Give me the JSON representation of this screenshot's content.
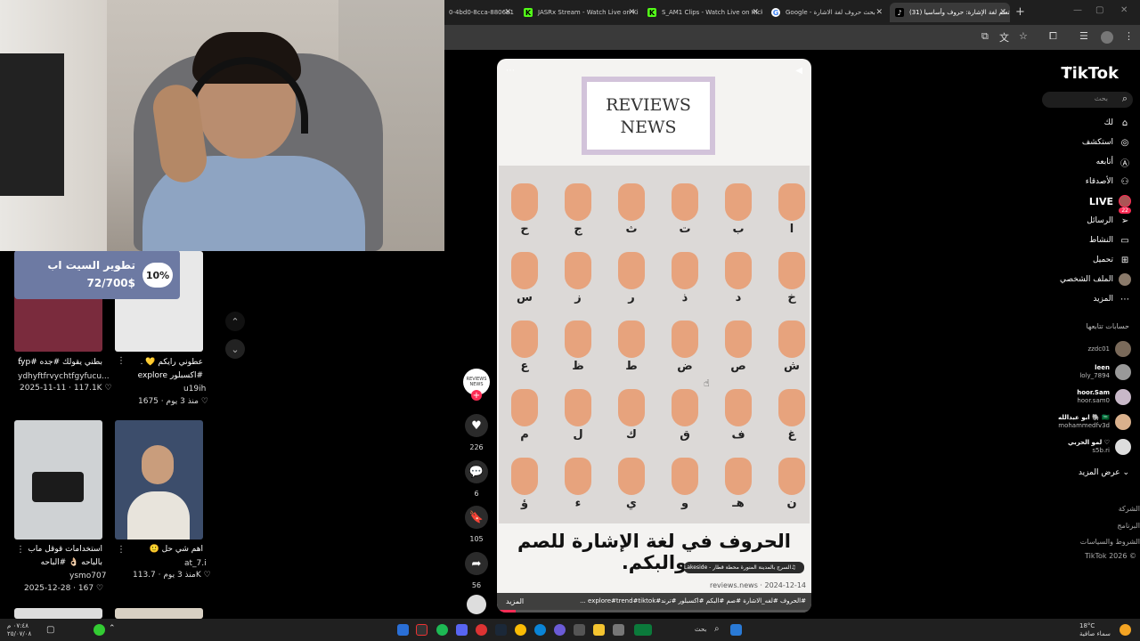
{
  "browser": {
    "tabs": [
      {
        "title": "0-4bd0-8cca-8806b1",
        "favicon": "blank"
      },
      {
        "title": "JASRx Stream - Watch Live on Kick",
        "favicon": "kick-icon"
      },
      {
        "title": "S_AM1 Clips - Watch Live on Kick",
        "favicon": "kick-icon"
      },
      {
        "title": "Google - بحث حروف لغة الاشارة",
        "favicon": "google-icon"
      },
      {
        "title": "(31) تعلم لغة الإشارة: حروف وأساسيا",
        "favicon": "tiktok-icon"
      }
    ],
    "new_tab": "+"
  },
  "donation_goal": {
    "title": "تطوير السيت اب",
    "amount": "72/700$",
    "percent_label": "10%",
    "progress": 0.1
  },
  "profile_grid": {
    "videos": [
      {
        "title": "بطني يقولك #جده #fyp",
        "user": "ydhyftfrvychtfgyfucu...",
        "date": "2025-11-11",
        "likes": "117.1K"
      },
      {
        "title": "عطوني رايكم 💛 .",
        "tag": "#اكسبلور explore",
        "user": "u19ih",
        "date": "منذ 3 يوم",
        "likes": "1675"
      },
      {
        "title": "استخدامات قوقل ماب",
        "tag": "بالباحه 👌🏻 #الباحه",
        "user": "ysmo707",
        "date": "2025-12-28",
        "likes": "167"
      },
      {
        "title": "اهم شي حل 🙂",
        "tag": "",
        "user": "at_7.i",
        "date": "منذ 3 يوم",
        "likes": "113.7K"
      }
    ],
    "up_arrow": "⌃",
    "down_arrow": "⌄"
  },
  "main_video": {
    "logo_line1": "REVIEWS",
    "logo_line2": "NEWS",
    "title_ar": "الحروف في لغة الإشارة للصم والبكم.",
    "music": "السرج بالمدينة المنورة محطة قطار - Lakeside",
    "date": "2024-12-14",
    "account": "reviews.news",
    "caption": "#الحروف #لغه_الاشارة #صم #البكم #اكسبلور #ترند#explore#trend#tiktok ...",
    "more_label": "المزيد",
    "progress": 0.06,
    "letters": [
      [
        "ح",
        "ج",
        "ث",
        "ت",
        "ب",
        "ا"
      ],
      [
        "س",
        "ز",
        "ر",
        "ذ",
        "د",
        "خ"
      ],
      [
        "ع",
        "ظ",
        "ط",
        "ض",
        "ص",
        "ش"
      ],
      [
        "م",
        "ل",
        "ك",
        "ق",
        "ف",
        "غ"
      ],
      [
        "ؤ",
        "ء",
        "ي",
        "و",
        "هـ",
        "ن"
      ]
    ]
  },
  "actions": {
    "avatar_label": "REVIEWS NEWS",
    "likes": "226",
    "comments": "6",
    "saves": "105",
    "shares": "56"
  },
  "sidebar": {
    "brand": "TikTok",
    "search_placeholder": "بحث",
    "nav": [
      {
        "label": "لك",
        "icon": "home-icon"
      },
      {
        "label": "استكشف",
        "icon": "compass-icon"
      },
      {
        "label": "أتابعه",
        "icon": "following-icon"
      },
      {
        "label": "الأصدقاء",
        "icon": "friends-icon"
      },
      {
        "label": "LIVE",
        "icon": "live-icon"
      },
      {
        "label": "الرسائل",
        "icon": "messages-icon",
        "badge": "22"
      },
      {
        "label": "النشاط",
        "icon": "activity-icon"
      },
      {
        "label": "تحميل",
        "icon": "upload-icon"
      },
      {
        "label": "الملف الشخصي",
        "icon": "profile-icon"
      },
      {
        "label": "المزيد",
        "icon": "more-icon"
      }
    ],
    "following_heading": "حسابات تتابعها",
    "following": [
      {
        "display": "",
        "user": "zzdc01"
      },
      {
        "display": "leen",
        "user": "loly_7894"
      },
      {
        "display": "hoor.Sam",
        "user": "hoor.sam0"
      },
      {
        "display": "ابو عبدالله 🐘 🇸🇦",
        "user": "mohammedfv3d"
      },
      {
        "display": "لمو الحربي ♡",
        "user": "s5b.ri"
      }
    ],
    "show_more": "عرض المزيد",
    "footer": [
      "الشركة",
      "البرنامج",
      "الشروط والسياسات",
      "© TikTok 2026"
    ]
  },
  "taskbar": {
    "time": "٠٧:٤٨ م",
    "date": "٢٥/٠٧/٠٨",
    "weather": "18°C",
    "weather_desc": "سماء صافية",
    "search_label": "بحث"
  }
}
